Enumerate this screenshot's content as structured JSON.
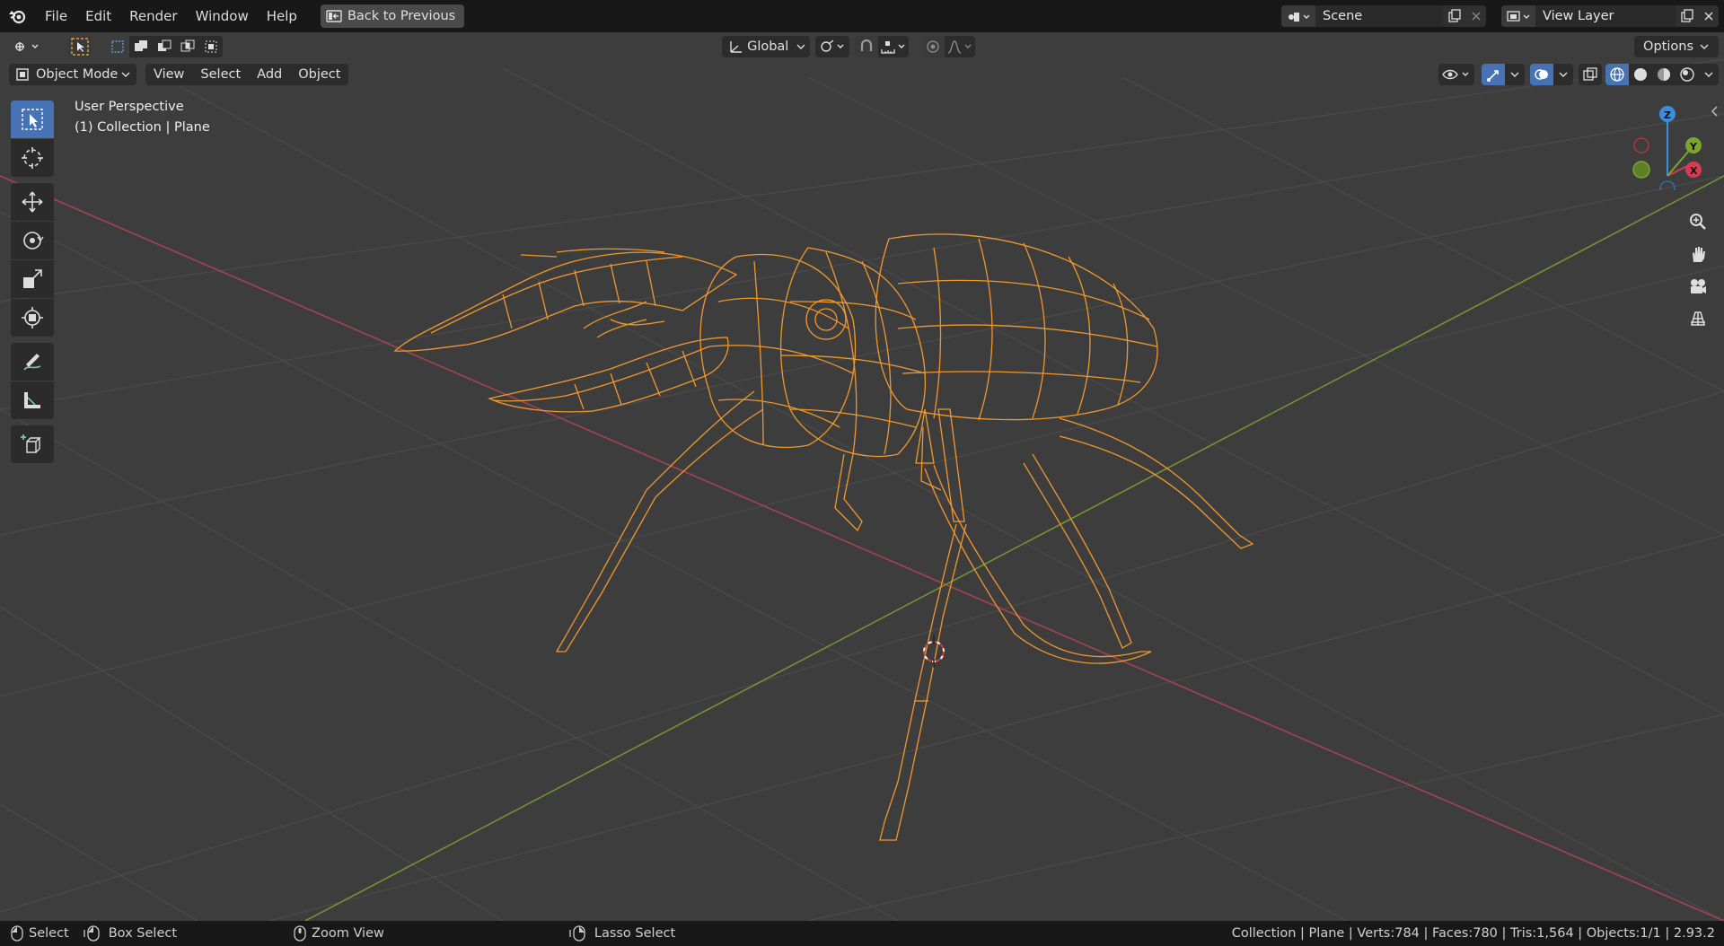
{
  "topbar": {
    "menus": [
      "File",
      "Edit",
      "Render",
      "Window",
      "Help"
    ],
    "back_button": "Back to Previous",
    "scene_name": "Scene",
    "view_layer_name": "View Layer"
  },
  "header": {
    "transform_orientation": "Global",
    "options_label": "Options",
    "mode_label": "Object Mode",
    "menus": [
      "View",
      "Select",
      "Add",
      "Object"
    ]
  },
  "viewport": {
    "perspective_label": "User Perspective",
    "collection_label": "(1) Collection | Plane",
    "gizmo": {
      "x": "X",
      "y": "Y",
      "z": "Z"
    }
  },
  "statusbar": {
    "select": "Select",
    "box_select": "Box Select",
    "zoom_view": "Zoom View",
    "lasso_select": "Lasso Select",
    "stats": "Collection | Plane | Verts:784 | Faces:780 | Tris:1,564 | Objects:1/1 | 2.93.2"
  },
  "colors": {
    "background": "#3d3d3d",
    "grid": "#4a4a4a",
    "x_axis": "#a34450",
    "y_axis": "#6f9433",
    "wireframe": "#f0982e",
    "active_tool": "#4772b3"
  }
}
